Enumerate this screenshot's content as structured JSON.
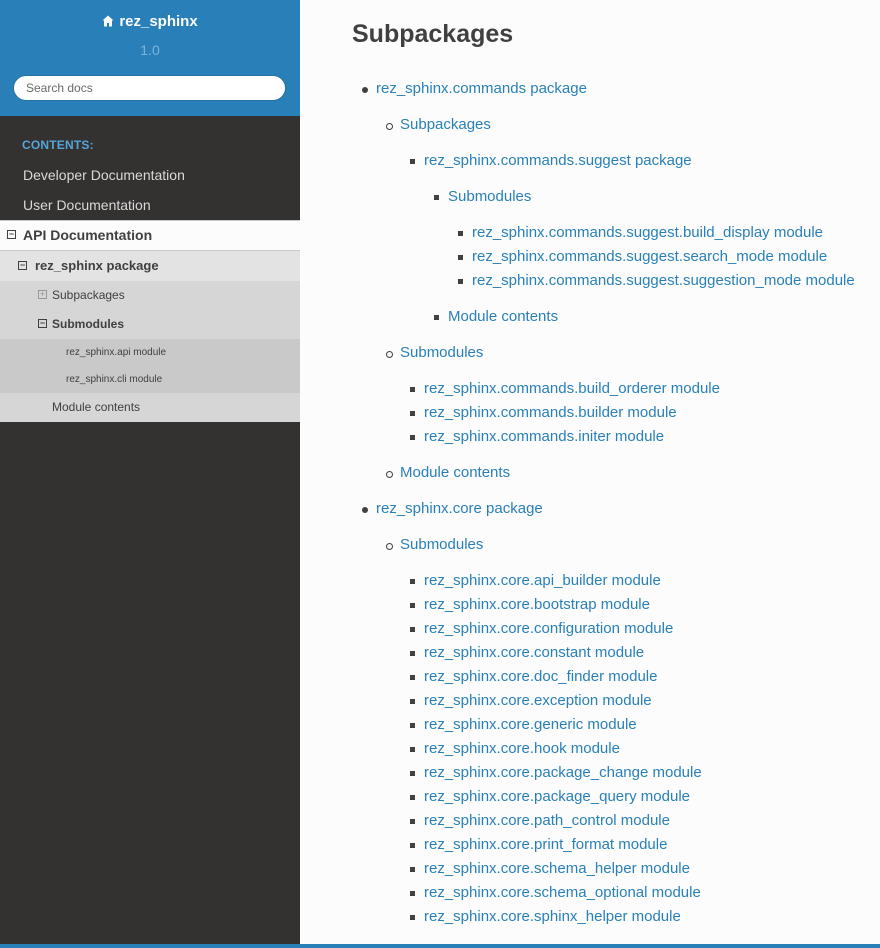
{
  "sidebar": {
    "home_title": "rez_sphinx",
    "home_icon": "home-icon",
    "version": "1.0",
    "search_placeholder": "Search docs",
    "caption": "Contents:",
    "top_links": [
      "Developer Documentation",
      "User Documentation"
    ],
    "current": {
      "label": "API Documentation",
      "package": {
        "label": "rez_sphinx package",
        "subpackages": "Subpackages",
        "submodules": {
          "label": "Submodules",
          "items": [
            "rez_sphinx.api module",
            "rez_sphinx.cli module"
          ]
        },
        "module_contents": "Module contents"
      }
    }
  },
  "main": {
    "title": "Subpackages",
    "toc": [
      "rez_sphinx.commands package",
      "Subpackages",
      "rez_sphinx.commands.suggest package",
      "Submodules",
      "rez_sphinx.commands.suggest.build_display module",
      "rez_sphinx.commands.suggest.search_mode module",
      "rez_sphinx.commands.suggest.suggestion_mode module",
      "Module contents",
      "Submodules",
      "rez_sphinx.commands.build_orderer module",
      "rez_sphinx.commands.builder module",
      "rez_sphinx.commands.initer module",
      "Module contents",
      "rez_sphinx.core package",
      "Submodules",
      "rez_sphinx.core.api_builder module",
      "rez_sphinx.core.bootstrap module",
      "rez_sphinx.core.configuration module",
      "rez_sphinx.core.constant module",
      "rez_sphinx.core.doc_finder module",
      "rez_sphinx.core.exception module",
      "rez_sphinx.core.generic module",
      "rez_sphinx.core.hook module",
      "rez_sphinx.core.package_change module",
      "rez_sphinx.core.package_query module",
      "rez_sphinx.core.path_control module",
      "rez_sphinx.core.print_format module",
      "rez_sphinx.core.schema_helper module",
      "rez_sphinx.core.schema_optional module",
      "rez_sphinx.core.sphinx_helper module"
    ]
  },
  "colors": {
    "sidebar_bg": "#343131",
    "header_bg": "#2980b9",
    "link": "#2980b9",
    "caption": "#55a5d9",
    "text": "#404040"
  }
}
